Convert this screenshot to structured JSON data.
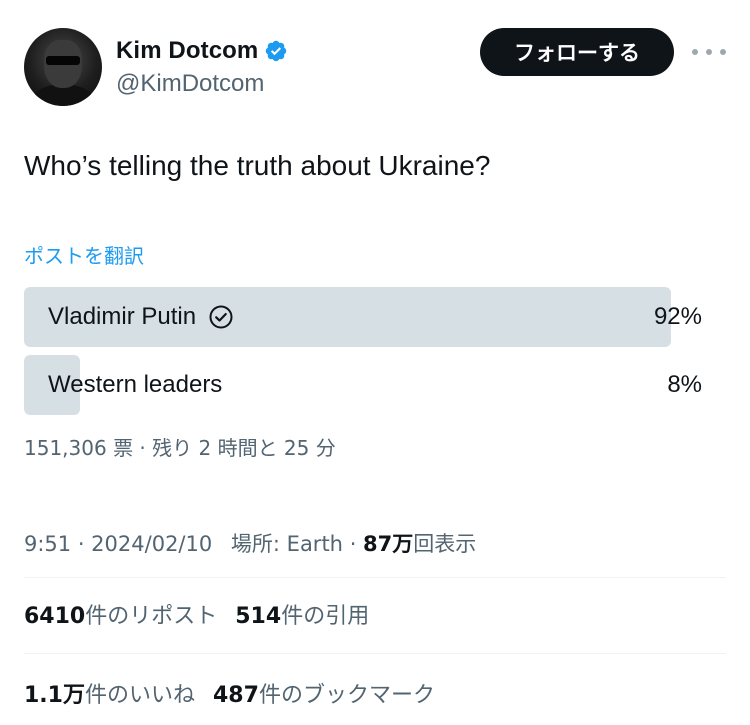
{
  "author": {
    "display_name": "Kim Dotcom",
    "handle": "@KimDotcom",
    "verified": true
  },
  "follow_label": "フォローする",
  "tweet_text": "Who’s telling the truth about Ukraine?",
  "translate_label": "ポストを翻訳",
  "poll": {
    "options": [
      {
        "label": "Vladimir Putin",
        "percent_label": "92%",
        "percent": 92,
        "winner": true
      },
      {
        "label": "Western leaders",
        "percent_label": "8%",
        "percent": 8,
        "winner": false
      }
    ],
    "meta": "151,306 票 · 残り 2 時間と 25 分"
  },
  "timestamp": {
    "time": "9:51 · 2024/02/10",
    "location": "場所: Earth",
    "sep": " · ",
    "views_count": "87万",
    "views_label": "回表示"
  },
  "stats": {
    "reposts_count": "6410",
    "reposts_label": "件のリポスト",
    "quotes_count": "514",
    "quotes_label": "件の引用",
    "likes_count": "1.1万",
    "likes_label": "件のいいね",
    "bookmarks_count": "487",
    "bookmarks_label": "件のブックマーク"
  },
  "colors": {
    "accent": "#1d9bf0",
    "text": "#0f1419",
    "secondary": "#536471",
    "poll_bar": "#cfd9de"
  },
  "icons": [
    "verified-badge-icon",
    "more-icon",
    "check-circle-icon"
  ]
}
